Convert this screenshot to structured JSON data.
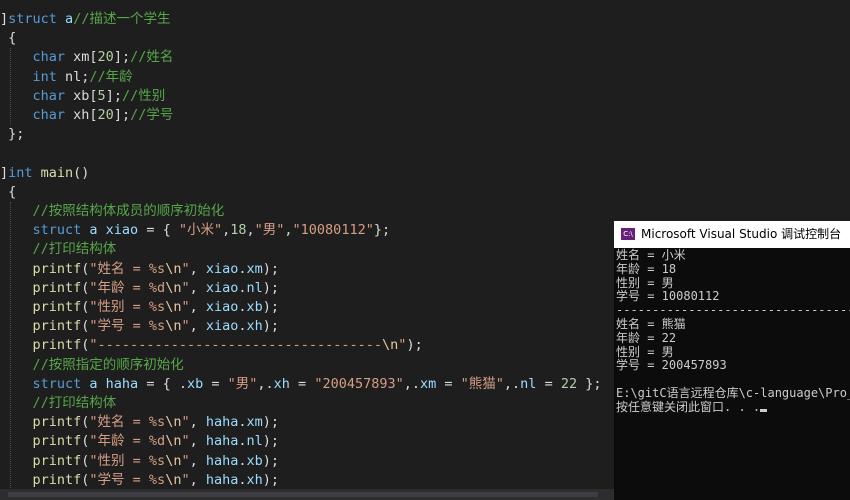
{
  "editor": {
    "lines": [
      {
        "t": [
          [
            "]",
            "punc"
          ],
          [
            "struct",
            "kw"
          ],
          [
            " a",
            "id"
          ],
          [
            "//描述一个学生",
            "cm"
          ]
        ]
      },
      {
        "t": [
          [
            " {",
            "punc"
          ]
        ]
      },
      {
        "t": [
          [
            "    char",
            "kw"
          ],
          [
            " xm[",
            "punc"
          ],
          [
            "20",
            "num"
          ],
          [
            "];",
            "punc"
          ],
          [
            "//姓名",
            "cm"
          ]
        ]
      },
      {
        "t": [
          [
            "    int",
            "kw"
          ],
          [
            " nl;",
            "punc"
          ],
          [
            "//年龄",
            "cm"
          ]
        ]
      },
      {
        "t": [
          [
            "    char",
            "kw"
          ],
          [
            " xb[",
            "punc"
          ],
          [
            "5",
            "num"
          ],
          [
            "];",
            "punc"
          ],
          [
            "//性别",
            "cm"
          ]
        ]
      },
      {
        "t": [
          [
            "    char",
            "kw"
          ],
          [
            " xh[",
            "punc"
          ],
          [
            "20",
            "num"
          ],
          [
            "];",
            "punc"
          ],
          [
            "//学号",
            "cm"
          ]
        ]
      },
      {
        "t": [
          [
            " };",
            "punc"
          ]
        ]
      },
      {
        "t": [
          [
            "",
            "punc"
          ]
        ]
      },
      {
        "t": [
          [
            "]",
            "punc"
          ],
          [
            "int",
            "kw"
          ],
          [
            " main",
            "fn"
          ],
          [
            "()",
            "punc"
          ]
        ]
      },
      {
        "t": [
          [
            " {",
            "punc"
          ]
        ]
      },
      {
        "t": [
          [
            "    //按照结构体成员的顺序初始化",
            "cm"
          ]
        ]
      },
      {
        "t": [
          [
            "    struct",
            "kw"
          ],
          [
            " a",
            "id"
          ],
          [
            " xiao",
            "id"
          ],
          [
            " = { ",
            "punc"
          ],
          [
            "\"小米\"",
            "str"
          ],
          [
            ",",
            "punc"
          ],
          [
            "18",
            "num"
          ],
          [
            ",",
            "punc"
          ],
          [
            "\"男\"",
            "str"
          ],
          [
            ",",
            "punc"
          ],
          [
            "\"10080112\"",
            "str"
          ],
          [
            "};",
            "punc"
          ]
        ]
      },
      {
        "t": [
          [
            "    //打印结构体",
            "cm"
          ]
        ]
      },
      {
        "t": [
          [
            "    printf",
            "fn"
          ],
          [
            "(",
            "punc"
          ],
          [
            "\"姓名 = %s",
            "str"
          ],
          [
            "\\n",
            "esc"
          ],
          [
            "\"",
            "str"
          ],
          [
            ", ",
            "punc"
          ],
          [
            "xiao",
            "id"
          ],
          [
            ".",
            "punc"
          ],
          [
            "xm",
            "id"
          ],
          [
            ");",
            "punc"
          ]
        ]
      },
      {
        "t": [
          [
            "    printf",
            "fn"
          ],
          [
            "(",
            "punc"
          ],
          [
            "\"年龄 = %d",
            "str"
          ],
          [
            "\\n",
            "esc"
          ],
          [
            "\"",
            "str"
          ],
          [
            ", ",
            "punc"
          ],
          [
            "xiao",
            "id"
          ],
          [
            ".",
            "punc"
          ],
          [
            "nl",
            "id"
          ],
          [
            ");",
            "punc"
          ]
        ]
      },
      {
        "t": [
          [
            "    printf",
            "fn"
          ],
          [
            "(",
            "punc"
          ],
          [
            "\"性别 = %s",
            "str"
          ],
          [
            "\\n",
            "esc"
          ],
          [
            "\"",
            "str"
          ],
          [
            ", ",
            "punc"
          ],
          [
            "xiao",
            "id"
          ],
          [
            ".",
            "punc"
          ],
          [
            "xb",
            "id"
          ],
          [
            ");",
            "punc"
          ]
        ]
      },
      {
        "t": [
          [
            "    printf",
            "fn"
          ],
          [
            "(",
            "punc"
          ],
          [
            "\"学号 = %s",
            "str"
          ],
          [
            "\\n",
            "esc"
          ],
          [
            "\"",
            "str"
          ],
          [
            ", ",
            "punc"
          ],
          [
            "xiao",
            "id"
          ],
          [
            ".",
            "punc"
          ],
          [
            "xh",
            "id"
          ],
          [
            ");",
            "punc"
          ]
        ]
      },
      {
        "t": [
          [
            "    printf",
            "fn"
          ],
          [
            "(",
            "punc"
          ],
          [
            "\"-----------------------------------",
            "str"
          ],
          [
            "\\n",
            "esc"
          ],
          [
            "\"",
            "str"
          ],
          [
            ");",
            "punc"
          ]
        ]
      },
      {
        "t": [
          [
            "    //按照指定的顺序初始化",
            "cm"
          ]
        ]
      },
      {
        "t": [
          [
            "    struct",
            "kw"
          ],
          [
            " a",
            "id"
          ],
          [
            " haha",
            "id"
          ],
          [
            " = { .",
            "punc"
          ],
          [
            "xb",
            "id"
          ],
          [
            " = ",
            "punc"
          ],
          [
            "\"男\"",
            "str"
          ],
          [
            ",.",
            "punc"
          ],
          [
            "xh",
            "id"
          ],
          [
            " = ",
            "punc"
          ],
          [
            "\"200457893\"",
            "str"
          ],
          [
            ",.",
            "punc"
          ],
          [
            "xm",
            "id"
          ],
          [
            " = ",
            "punc"
          ],
          [
            "\"熊猫\"",
            "str"
          ],
          [
            ",.",
            "punc"
          ],
          [
            "nl",
            "id"
          ],
          [
            " = ",
            "punc"
          ],
          [
            "22",
            "num"
          ],
          [
            " };",
            "punc"
          ]
        ]
      },
      {
        "t": [
          [
            "    //打印结构体",
            "cm"
          ]
        ]
      },
      {
        "t": [
          [
            "    printf",
            "fn"
          ],
          [
            "(",
            "punc"
          ],
          [
            "\"姓名 = %s",
            "str"
          ],
          [
            "\\n",
            "esc"
          ],
          [
            "\"",
            "str"
          ],
          [
            ", ",
            "punc"
          ],
          [
            "haha",
            "id"
          ],
          [
            ".",
            "punc"
          ],
          [
            "xm",
            "id"
          ],
          [
            ");",
            "punc"
          ]
        ]
      },
      {
        "t": [
          [
            "    printf",
            "fn"
          ],
          [
            "(",
            "punc"
          ],
          [
            "\"年龄 = %d",
            "str"
          ],
          [
            "\\n",
            "esc"
          ],
          [
            "\"",
            "str"
          ],
          [
            ", ",
            "punc"
          ],
          [
            "haha",
            "id"
          ],
          [
            ".",
            "punc"
          ],
          [
            "nl",
            "id"
          ],
          [
            ");",
            "punc"
          ]
        ]
      },
      {
        "t": [
          [
            "    printf",
            "fn"
          ],
          [
            "(",
            "punc"
          ],
          [
            "\"性别 = %s",
            "str"
          ],
          [
            "\\n",
            "esc"
          ],
          [
            "\"",
            "str"
          ],
          [
            ", ",
            "punc"
          ],
          [
            "haha",
            "id"
          ],
          [
            ".",
            "punc"
          ],
          [
            "xb",
            "id"
          ],
          [
            ");",
            "punc"
          ]
        ]
      },
      {
        "t": [
          [
            "    printf",
            "fn"
          ],
          [
            "(",
            "punc"
          ],
          [
            "\"学号 = %s",
            "str"
          ],
          [
            "\\n",
            "esc"
          ],
          [
            "\"",
            "str"
          ],
          [
            ", ",
            "punc"
          ],
          [
            "haha",
            "id"
          ],
          [
            ".",
            "punc"
          ],
          [
            "xh",
            "id"
          ],
          [
            ");",
            "punc"
          ]
        ]
      }
    ]
  },
  "console": {
    "icon_label": "C:\\",
    "title": "Microsoft Visual Studio 调试控制台",
    "lines": [
      "姓名 = 小米",
      "年龄 = 18",
      "性别 = 男",
      "学号 = 10080112",
      "------------------------------------------",
      "姓名 = 熊猫",
      "年龄 = 22",
      "性别 = 男",
      "学号 = 200457893",
      "",
      "E:\\gitC语言远程仓库\\c-language\\Pro_",
      "按任意键关闭此窗口. . ."
    ]
  },
  "colors": {
    "editor_bg": "#1e1e1e",
    "keyword": "#569cd6",
    "comment": "#57a64a",
    "string": "#d69d85",
    "console_bg": "#0c0c0c",
    "console_text": "#cccccc"
  }
}
